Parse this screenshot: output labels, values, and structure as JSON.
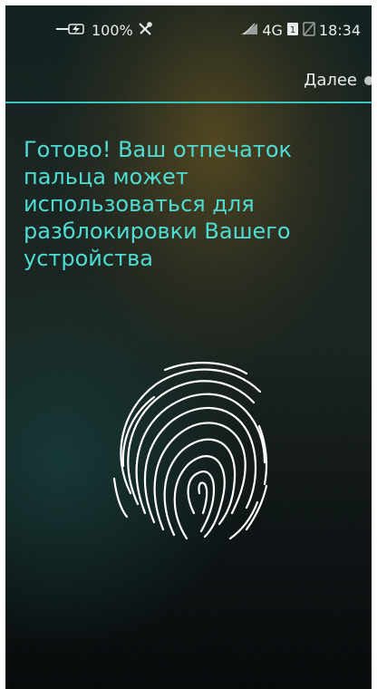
{
  "status_bar": {
    "battery_percent": "100%",
    "network": "4G",
    "sim_badge": "1",
    "time": "18:34",
    "icons": [
      "charging-icon",
      "tools-icon",
      "signal-icon",
      "sim-icon",
      "no-signal-icon"
    ]
  },
  "header": {
    "next_label": "Далее"
  },
  "main": {
    "message": "Готово! Ваш отпечаток пальца может использоваться для разблокировки Вашего устройства",
    "fingerprint_icon": "fingerprint-icon"
  },
  "colors": {
    "accent": "#4fdcd2",
    "divider": "#37c6bd",
    "text_light": "#e9ecea"
  }
}
